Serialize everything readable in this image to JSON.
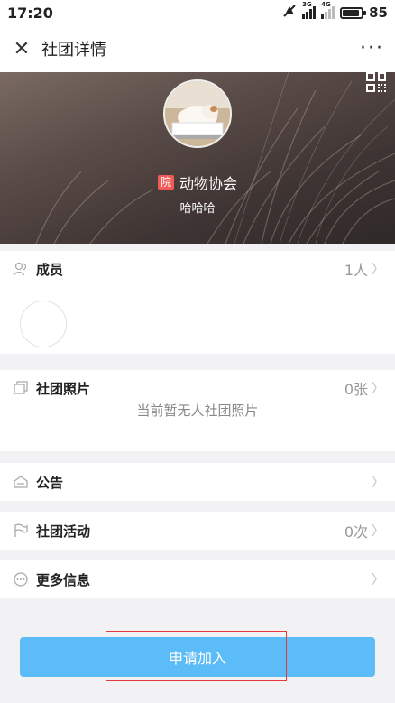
{
  "status": {
    "time": "17:20",
    "battery": "85",
    "net1": "3G",
    "net2": "4G"
  },
  "nav": {
    "title": "社团详情"
  },
  "club": {
    "badge": "院",
    "name": "动物协会",
    "subtitle": "哈哈哈"
  },
  "members": {
    "label": "成员",
    "count": "1人"
  },
  "photos": {
    "label": "社团照片",
    "count": "0张",
    "empty": "当前暂无人社团照片"
  },
  "notice": {
    "label": "公告"
  },
  "activities": {
    "label": "社团活动",
    "count": "0次"
  },
  "more_info": {
    "label": "更多信息"
  },
  "apply": {
    "label": "申请加入"
  },
  "colors": {
    "accent": "#5bbcf7",
    "badge": "#f25a5a",
    "highlight": "#e53935"
  }
}
